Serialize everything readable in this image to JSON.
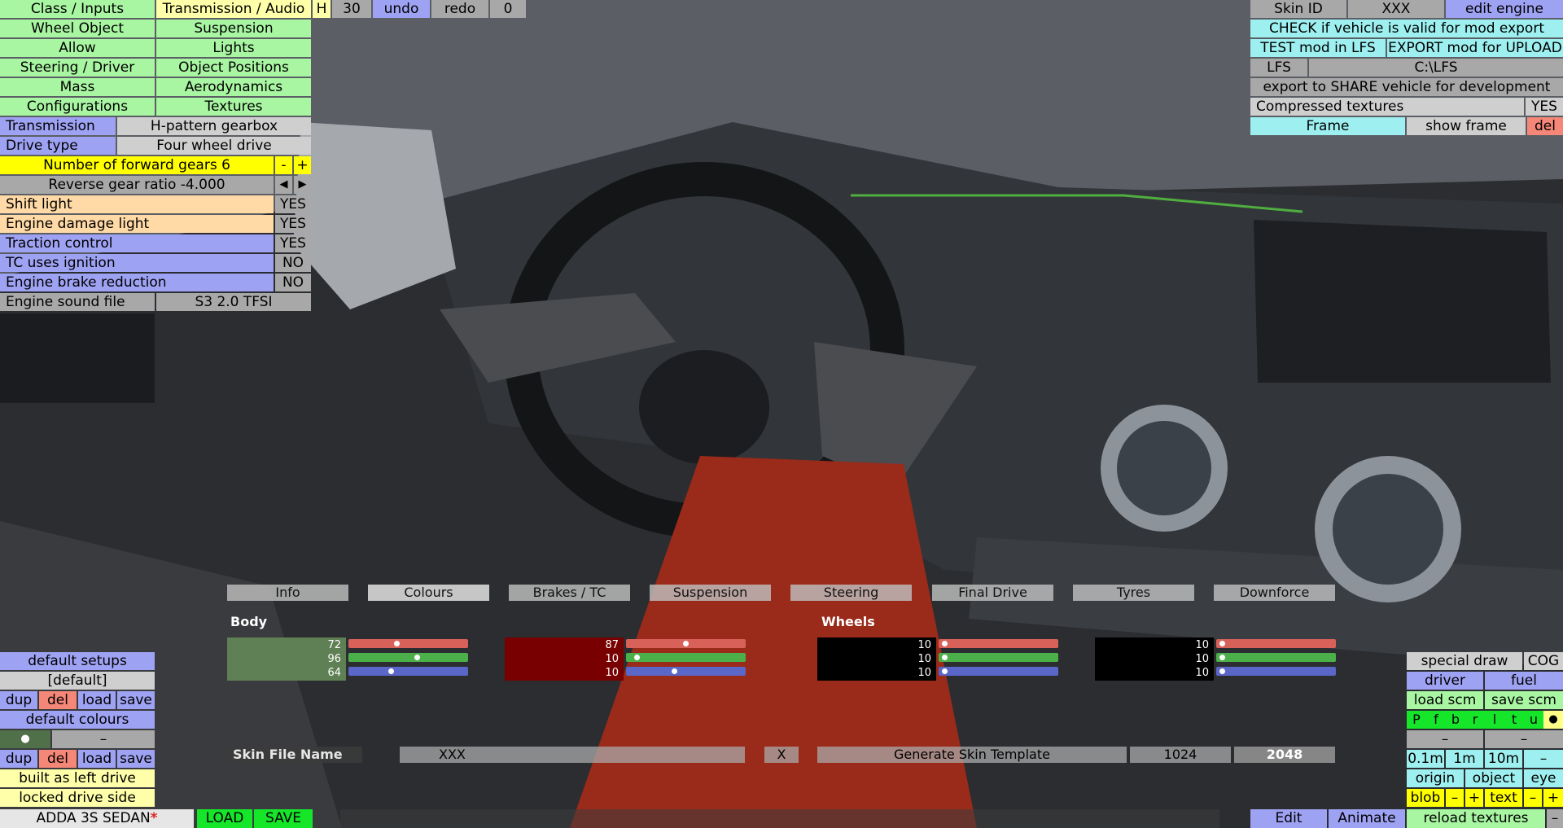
{
  "top_left_menu": {
    "row1": [
      "Class / Inputs",
      "Transmission / Audio"
    ],
    "row2": [
      "Wheel Object",
      "Suspension"
    ],
    "row3": [
      "Allow",
      "Lights"
    ],
    "row4": [
      "Steering / Driver",
      "Object Positions"
    ],
    "row5": [
      "Mass",
      "Aerodynamics"
    ],
    "row6": [
      "Configurations",
      "Textures"
    ],
    "h_label": "H",
    "history_count": "30",
    "undo": "undo",
    "redo": "redo",
    "redo_count": "0"
  },
  "transmission_panel": {
    "transmission_label": "Transmission",
    "transmission_value": "H-pattern gearbox",
    "drive_type_label": "Drive type",
    "drive_type_value": "Four wheel drive",
    "forward_gears": "Number of forward gears 6",
    "minus": "-",
    "plus": "+",
    "reverse_ratio": "Reverse gear ratio -4.000",
    "left_arrow": "◀",
    "right_arrow": "▶",
    "toggles": [
      {
        "label": "Shift light",
        "value": "YES"
      },
      {
        "label": "Engine damage light",
        "value": "YES"
      },
      {
        "label": "Traction control",
        "value": "YES"
      },
      {
        "label": "TC uses ignition",
        "value": "NO"
      },
      {
        "label": "Engine brake reduction",
        "value": "NO"
      }
    ],
    "sound_label": "Engine sound file",
    "sound_value": "S3 2.0 TFSI"
  },
  "top_right": {
    "skin_id_label": "Skin ID",
    "skin_id_value": "XXX",
    "edit_engine": "edit engine",
    "check_valid": "CHECK if vehicle is valid for mod export",
    "test_mod": "TEST mod in LFS",
    "export_mod": "EXPORT mod for UPLOAD",
    "lfs_label": "LFS",
    "lfs_path": "C:\\LFS",
    "export_share": "export to SHARE vehicle for development",
    "compressed_label": "Compressed textures",
    "compressed_value": "YES",
    "frame": "Frame",
    "show_frame": "show frame",
    "del": "del"
  },
  "colour_tabs": [
    "Info",
    "Colours",
    "Brakes / TC",
    "Suspension",
    "Steering",
    "Final Drive",
    "Tyres",
    "Downforce"
  ],
  "colours": {
    "body_label": "Body",
    "wheels_label": "Wheels",
    "body_swatch": {
      "color": "#5f7f54",
      "values": [
        "72",
        "96",
        "64"
      ],
      "sliders": [
        0.4,
        0.58,
        0.35
      ]
    },
    "second_swatch": {
      "color": "#780000",
      "values": [
        "87",
        "10",
        "10"
      ],
      "sliders": [
        0.5,
        0.07,
        0.4
      ]
    },
    "wheels_swatch": {
      "color": "#000000",
      "values": [
        "10",
        "10",
        "10"
      ],
      "sliders": [
        0.03,
        0.03,
        0.03
      ]
    },
    "fourth_swatch": {
      "color": "#000000",
      "values": [
        "10",
        "10",
        "10"
      ],
      "sliders": [
        0.03,
        0.03,
        0.03
      ]
    }
  },
  "skin_bar": {
    "file_name_label": "Skin File Name",
    "file_name_value": "XXX",
    "clear": "X",
    "generate": "Generate Skin Template",
    "size_1024": "1024",
    "size_2048": "2048"
  },
  "bottom_left": {
    "default_setups": "default setups",
    "default_bracket": "[default]",
    "dup": "dup",
    "del": "del",
    "load": "load",
    "save": "save",
    "default_colours": "default colours",
    "bullet": "●",
    "dash": "–",
    "built_left": "built as left drive",
    "locked_side": "locked drive side",
    "vehicle_name": "ADDA 3S SEDAN",
    "asterisk": "*",
    "load_btn": "LOAD",
    "save_btn": "SAVE"
  },
  "bottom_right": {
    "special_draw": "special draw",
    "cog": "COG",
    "driver": "driver",
    "fuel": "fuel",
    "load_scm": "load scm",
    "save_scm": "save scm",
    "letters": [
      "P",
      "f",
      "b",
      "r",
      "l",
      "t",
      "u",
      "●"
    ],
    "dash_a": "–",
    "dash_b": "–",
    "scale_01": "0.1m",
    "scale_1": "1m",
    "scale_10": "10m",
    "minus": "–",
    "origin": "origin",
    "object": "object",
    "eye": "eye",
    "blob": "blob",
    "blob_minus": "–",
    "blob_plus": "+",
    "text": "text",
    "text_minus": "–",
    "text_plus": "+",
    "edit": "Edit",
    "animate": "Animate",
    "reload_textures": "reload textures",
    "reload_minus": "–"
  }
}
